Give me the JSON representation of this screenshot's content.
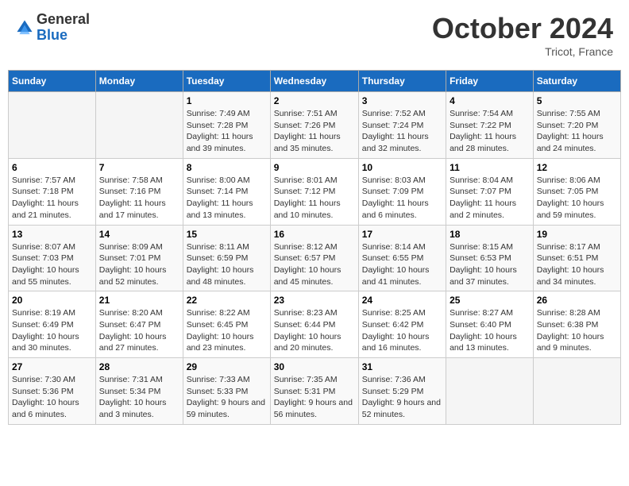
{
  "header": {
    "logo_general": "General",
    "logo_blue": "Blue",
    "month_title": "October 2024",
    "subtitle": "Tricot, France"
  },
  "weekdays": [
    "Sunday",
    "Monday",
    "Tuesday",
    "Wednesday",
    "Thursday",
    "Friday",
    "Saturday"
  ],
  "weeks": [
    [
      {
        "day": "",
        "sunrise": "",
        "sunset": "",
        "daylight": ""
      },
      {
        "day": "",
        "sunrise": "",
        "sunset": "",
        "daylight": ""
      },
      {
        "day": "1",
        "sunrise": "Sunrise: 7:49 AM",
        "sunset": "Sunset: 7:28 PM",
        "daylight": "Daylight: 11 hours and 39 minutes."
      },
      {
        "day": "2",
        "sunrise": "Sunrise: 7:51 AM",
        "sunset": "Sunset: 7:26 PM",
        "daylight": "Daylight: 11 hours and 35 minutes."
      },
      {
        "day": "3",
        "sunrise": "Sunrise: 7:52 AM",
        "sunset": "Sunset: 7:24 PM",
        "daylight": "Daylight: 11 hours and 32 minutes."
      },
      {
        "day": "4",
        "sunrise": "Sunrise: 7:54 AM",
        "sunset": "Sunset: 7:22 PM",
        "daylight": "Daylight: 11 hours and 28 minutes."
      },
      {
        "day": "5",
        "sunrise": "Sunrise: 7:55 AM",
        "sunset": "Sunset: 7:20 PM",
        "daylight": "Daylight: 11 hours and 24 minutes."
      }
    ],
    [
      {
        "day": "6",
        "sunrise": "Sunrise: 7:57 AM",
        "sunset": "Sunset: 7:18 PM",
        "daylight": "Daylight: 11 hours and 21 minutes."
      },
      {
        "day": "7",
        "sunrise": "Sunrise: 7:58 AM",
        "sunset": "Sunset: 7:16 PM",
        "daylight": "Daylight: 11 hours and 17 minutes."
      },
      {
        "day": "8",
        "sunrise": "Sunrise: 8:00 AM",
        "sunset": "Sunset: 7:14 PM",
        "daylight": "Daylight: 11 hours and 13 minutes."
      },
      {
        "day": "9",
        "sunrise": "Sunrise: 8:01 AM",
        "sunset": "Sunset: 7:12 PM",
        "daylight": "Daylight: 11 hours and 10 minutes."
      },
      {
        "day": "10",
        "sunrise": "Sunrise: 8:03 AM",
        "sunset": "Sunset: 7:09 PM",
        "daylight": "Daylight: 11 hours and 6 minutes."
      },
      {
        "day": "11",
        "sunrise": "Sunrise: 8:04 AM",
        "sunset": "Sunset: 7:07 PM",
        "daylight": "Daylight: 11 hours and 2 minutes."
      },
      {
        "day": "12",
        "sunrise": "Sunrise: 8:06 AM",
        "sunset": "Sunset: 7:05 PM",
        "daylight": "Daylight: 10 hours and 59 minutes."
      }
    ],
    [
      {
        "day": "13",
        "sunrise": "Sunrise: 8:07 AM",
        "sunset": "Sunset: 7:03 PM",
        "daylight": "Daylight: 10 hours and 55 minutes."
      },
      {
        "day": "14",
        "sunrise": "Sunrise: 8:09 AM",
        "sunset": "Sunset: 7:01 PM",
        "daylight": "Daylight: 10 hours and 52 minutes."
      },
      {
        "day": "15",
        "sunrise": "Sunrise: 8:11 AM",
        "sunset": "Sunset: 6:59 PM",
        "daylight": "Daylight: 10 hours and 48 minutes."
      },
      {
        "day": "16",
        "sunrise": "Sunrise: 8:12 AM",
        "sunset": "Sunset: 6:57 PM",
        "daylight": "Daylight: 10 hours and 45 minutes."
      },
      {
        "day": "17",
        "sunrise": "Sunrise: 8:14 AM",
        "sunset": "Sunset: 6:55 PM",
        "daylight": "Daylight: 10 hours and 41 minutes."
      },
      {
        "day": "18",
        "sunrise": "Sunrise: 8:15 AM",
        "sunset": "Sunset: 6:53 PM",
        "daylight": "Daylight: 10 hours and 37 minutes."
      },
      {
        "day": "19",
        "sunrise": "Sunrise: 8:17 AM",
        "sunset": "Sunset: 6:51 PM",
        "daylight": "Daylight: 10 hours and 34 minutes."
      }
    ],
    [
      {
        "day": "20",
        "sunrise": "Sunrise: 8:19 AM",
        "sunset": "Sunset: 6:49 PM",
        "daylight": "Daylight: 10 hours and 30 minutes."
      },
      {
        "day": "21",
        "sunrise": "Sunrise: 8:20 AM",
        "sunset": "Sunset: 6:47 PM",
        "daylight": "Daylight: 10 hours and 27 minutes."
      },
      {
        "day": "22",
        "sunrise": "Sunrise: 8:22 AM",
        "sunset": "Sunset: 6:45 PM",
        "daylight": "Daylight: 10 hours and 23 minutes."
      },
      {
        "day": "23",
        "sunrise": "Sunrise: 8:23 AM",
        "sunset": "Sunset: 6:44 PM",
        "daylight": "Daylight: 10 hours and 20 minutes."
      },
      {
        "day": "24",
        "sunrise": "Sunrise: 8:25 AM",
        "sunset": "Sunset: 6:42 PM",
        "daylight": "Daylight: 10 hours and 16 minutes."
      },
      {
        "day": "25",
        "sunrise": "Sunrise: 8:27 AM",
        "sunset": "Sunset: 6:40 PM",
        "daylight": "Daylight: 10 hours and 13 minutes."
      },
      {
        "day": "26",
        "sunrise": "Sunrise: 8:28 AM",
        "sunset": "Sunset: 6:38 PM",
        "daylight": "Daylight: 10 hours and 9 minutes."
      }
    ],
    [
      {
        "day": "27",
        "sunrise": "Sunrise: 7:30 AM",
        "sunset": "Sunset: 5:36 PM",
        "daylight": "Daylight: 10 hours and 6 minutes."
      },
      {
        "day": "28",
        "sunrise": "Sunrise: 7:31 AM",
        "sunset": "Sunset: 5:34 PM",
        "daylight": "Daylight: 10 hours and 3 minutes."
      },
      {
        "day": "29",
        "sunrise": "Sunrise: 7:33 AM",
        "sunset": "Sunset: 5:33 PM",
        "daylight": "Daylight: 9 hours and 59 minutes."
      },
      {
        "day": "30",
        "sunrise": "Sunrise: 7:35 AM",
        "sunset": "Sunset: 5:31 PM",
        "daylight": "Daylight: 9 hours and 56 minutes."
      },
      {
        "day": "31",
        "sunrise": "Sunrise: 7:36 AM",
        "sunset": "Sunset: 5:29 PM",
        "daylight": "Daylight: 9 hours and 52 minutes."
      },
      {
        "day": "",
        "sunrise": "",
        "sunset": "",
        "daylight": ""
      },
      {
        "day": "",
        "sunrise": "",
        "sunset": "",
        "daylight": ""
      }
    ]
  ]
}
